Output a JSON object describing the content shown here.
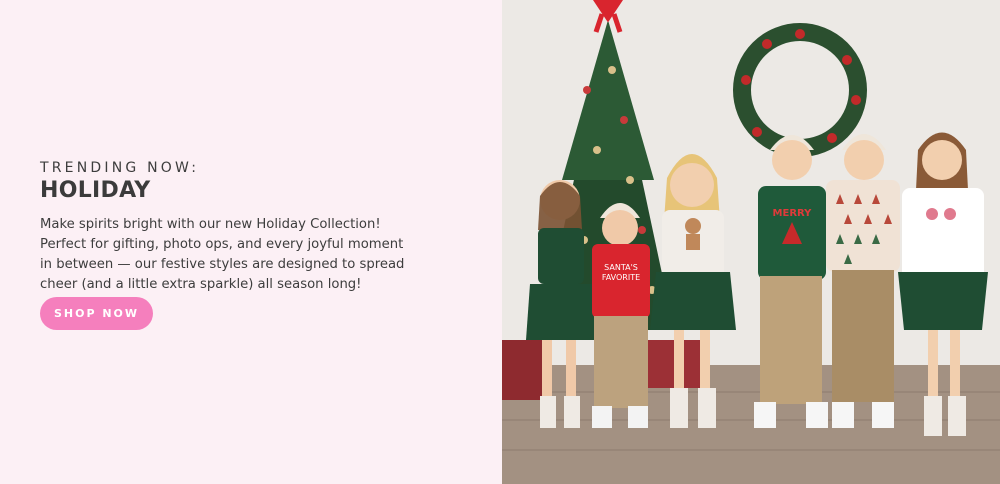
{
  "promo": {
    "eyebrow": "TRENDING NOW:",
    "headline": "HOLIDAY",
    "description": "Make spirits bright with our new Holiday Collection! Perfect for gifting, photo ops, and every joyful moment in between — our festive styles are designed to spread cheer (and a little extra sparkle) all season long!",
    "cta_label": "SHOP NOW"
  },
  "photo": {
    "shirt_text_merry": "MERRY",
    "shirt_text_santa_line1": "SANTA'S",
    "shirt_text_santa_line2": "FAVORITE"
  },
  "colors": {
    "panel_background": "#fcf0f5",
    "button_pink": "#f57fbd",
    "text_dark": "#3d3d3d",
    "holiday_green": "#1f4d33",
    "holiday_red": "#d9252e"
  }
}
